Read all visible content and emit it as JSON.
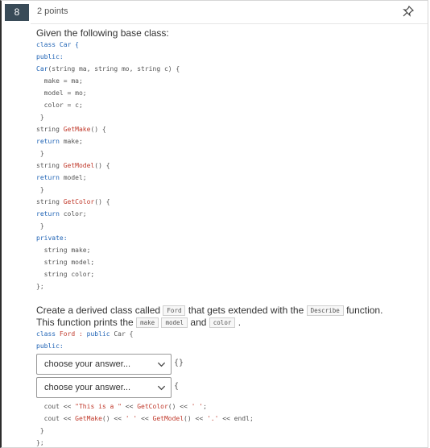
{
  "question": {
    "number": "8",
    "points": "2 points",
    "pin_icon": "pin-icon",
    "intro": "Given the following base class:"
  },
  "code_top": [
    [
      {
        "t": "class",
        "c": "kw"
      },
      {
        "t": " Car {",
        "c": "kw"
      }
    ],
    [
      {
        "t": "public:",
        "c": "kw"
      }
    ],
    [
      {
        "t": "Car",
        "c": "kw"
      },
      {
        "t": "(string ma, string mo, string c) {",
        "c": ""
      }
    ],
    [
      {
        "t": "  make = ma;",
        "c": ""
      }
    ],
    [
      {
        "t": "  model = mo;",
        "c": ""
      }
    ],
    [
      {
        "t": "  color = c;",
        "c": ""
      }
    ],
    [
      {
        "t": " }",
        "c": ""
      }
    ],
    [
      {
        "t": "string ",
        "c": ""
      },
      {
        "t": "GetMake",
        "c": "fn"
      },
      {
        "t": "() {",
        "c": ""
      }
    ],
    [
      {
        "t": "return",
        "c": "kw"
      },
      {
        "t": " make;",
        "c": ""
      }
    ],
    [
      {
        "t": " }",
        "c": ""
      }
    ],
    [
      {
        "t": "string ",
        "c": ""
      },
      {
        "t": "GetModel",
        "c": "fn"
      },
      {
        "t": "() {",
        "c": ""
      }
    ],
    [
      {
        "t": "return",
        "c": "kw"
      },
      {
        "t": " model;",
        "c": ""
      }
    ],
    [
      {
        "t": " }",
        "c": ""
      }
    ],
    [
      {
        "t": "string ",
        "c": ""
      },
      {
        "t": "GetColor",
        "c": "fn"
      },
      {
        "t": "() {",
        "c": ""
      }
    ],
    [
      {
        "t": "return",
        "c": "kw"
      },
      {
        "t": " color;",
        "c": ""
      }
    ],
    [
      {
        "t": " }",
        "c": ""
      }
    ],
    [
      {
        "t": "private:",
        "c": "kw"
      }
    ],
    [
      {
        "t": "  string make;",
        "c": ""
      }
    ],
    [
      {
        "t": "  string model;",
        "c": ""
      }
    ],
    [
      {
        "t": "  string color;",
        "c": ""
      }
    ],
    [
      {
        "t": "};",
        "c": ""
      }
    ]
  ],
  "task": {
    "line1_a": "Create a derived class called",
    "chip_ford": "Ford",
    "line1_b": "that gets extended with the",
    "chip_describe": "Describe",
    "line1_c": "function.",
    "line2_a": "This function prints the",
    "chip_make": "make",
    "chip_model": "model",
    "line2_and": "and",
    "chip_color": "color",
    "line2_end": "."
  },
  "code_mid": [
    [
      {
        "t": "class",
        "c": "kw"
      },
      {
        "t": " Ford : ",
        "c": "fn"
      },
      {
        "t": "public",
        "c": "kw"
      },
      {
        "t": " Car {",
        "c": ""
      }
    ],
    [
      {
        "t": "public:",
        "c": "kw"
      }
    ]
  ],
  "answers": [
    {
      "value": "choose your answer...",
      "suffix": "{}"
    },
    {
      "value": "choose your answer...",
      "suffix": "{"
    }
  ],
  "code_bottom": [
    [
      {
        "t": "  cout << ",
        "c": ""
      },
      {
        "t": "\"This is a \"",
        "c": "str"
      },
      {
        "t": " << ",
        "c": ""
      },
      {
        "t": "GetColor",
        "c": "fn"
      },
      {
        "t": "() << ",
        "c": ""
      },
      {
        "t": "' '",
        "c": "str"
      },
      {
        "t": ";",
        "c": ""
      }
    ],
    [
      {
        "t": "  cout << ",
        "c": ""
      },
      {
        "t": "GetMake",
        "c": "fn"
      },
      {
        "t": "() << ",
        "c": ""
      },
      {
        "t": "' '",
        "c": "str"
      },
      {
        "t": " << ",
        "c": ""
      },
      {
        "t": "GetModel",
        "c": "fn"
      },
      {
        "t": "() << ",
        "c": ""
      },
      {
        "t": "'.'",
        "c": "str"
      },
      {
        "t": " << endl;",
        "c": ""
      }
    ],
    [
      {
        "t": " }",
        "c": ""
      }
    ],
    [
      {
        "t": "};",
        "c": ""
      }
    ]
  ]
}
